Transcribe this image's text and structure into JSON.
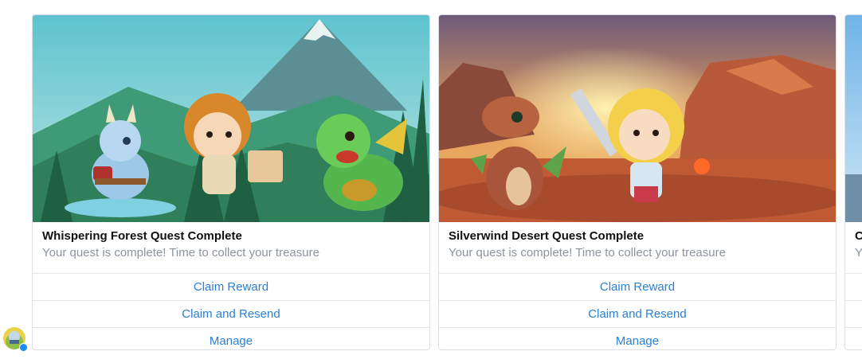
{
  "cards": [
    {
      "title": "Whispering Forest Quest Complete",
      "subtitle": "Your quest is complete! Time to collect your treasure",
      "actions": [
        "Claim Reward",
        "Claim and Resend",
        "Manage"
      ],
      "image_scene": "forest-mountain-dragons"
    },
    {
      "title": "Silverwind Desert Quest Complete",
      "subtitle": "Your quest is complete! Time to collect your treasure",
      "actions": [
        "Claim Reward",
        "Claim and Resend",
        "Manage"
      ],
      "image_scene": "desert-canyon-dragon-knight"
    },
    {
      "title": "C",
      "subtitle": "Y",
      "image_scene": "sky-partial"
    }
  ],
  "colors": {
    "link": "#2a7fd4",
    "title": "#111111",
    "subtitle": "#8d949e",
    "border": "#dcdfe3",
    "badge": "#1d8cf0"
  }
}
